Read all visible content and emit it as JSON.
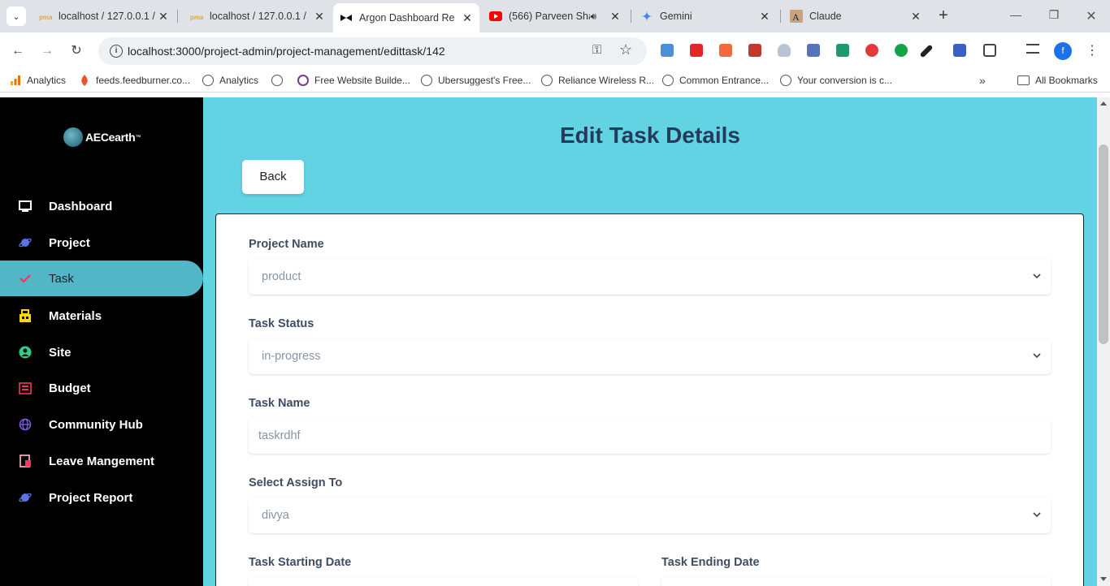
{
  "browser": {
    "tabs": [
      {
        "label": "localhost / 127.0.0.1 /",
        "icon": "phpmyadmin-icon"
      },
      {
        "label": "localhost / 127.0.0.1 /",
        "icon": "phpmyadmin-icon"
      },
      {
        "label": "Argon Dashboard Re",
        "icon": "argon-icon"
      },
      {
        "label": "(566) Parveen Sha",
        "icon": "youtube-icon"
      },
      {
        "label": "Gemini",
        "icon": "gemini-icon"
      },
      {
        "label": "Claude",
        "icon": "claude-icon"
      }
    ],
    "url": "localhost:3000/project-admin/project-management/edittask/142",
    "profile_initial": "f",
    "bookmarks": [
      {
        "label": "Analytics",
        "icon": "analytics-icon"
      },
      {
        "label": "feeds.feedburner.co...",
        "icon": "feedburner-icon"
      },
      {
        "label": "Analytics",
        "icon": "globe-icon"
      },
      {
        "label": "",
        "icon": "globe-icon"
      },
      {
        "label": "Free Website Builde...",
        "icon": "ring-icon"
      },
      {
        "label": "Ubersuggest's Free...",
        "icon": "globe-icon"
      },
      {
        "label": "Reliance Wireless R...",
        "icon": "globe-icon"
      },
      {
        "label": "Common Entrance...",
        "icon": "globe-icon"
      },
      {
        "label": "Your conversion is c...",
        "icon": "globe-icon"
      }
    ],
    "all_bookmarks": "All Bookmarks"
  },
  "sidebar": {
    "logo": {
      "text": "AECearth",
      "tm": "™"
    },
    "items": [
      {
        "label": "Dashboard",
        "icon": "monitor-icon"
      },
      {
        "label": "Project",
        "icon": "planet-icon"
      },
      {
        "label": "Task",
        "icon": "check-icon",
        "active": true
      },
      {
        "label": "Materials",
        "icon": "materials-icon"
      },
      {
        "label": "Site",
        "icon": "user-circle-icon"
      },
      {
        "label": "Budget",
        "icon": "budget-icon"
      },
      {
        "label": "Community Hub",
        "icon": "globe-icon"
      },
      {
        "label": "Leave Mangement",
        "icon": "leave-icon"
      },
      {
        "label": "Project Report",
        "icon": "planet-icon"
      }
    ]
  },
  "main": {
    "title": "Edit Task Details",
    "back_label": "Back",
    "form": {
      "project_name": {
        "label": "Project Name",
        "value": "product"
      },
      "task_status": {
        "label": "Task Status",
        "value": "in-progress"
      },
      "task_name": {
        "label": "Task Name",
        "value": "taskrdhf"
      },
      "assign_to": {
        "label": "Select Assign To",
        "value": "divya"
      },
      "start_date": {
        "label": "Task Starting Date"
      },
      "end_date": {
        "label": "Task Ending Date"
      }
    }
  },
  "colors": {
    "accent": "#62d3e3",
    "sidebar_active": "#51b7c7",
    "title": "#263a5a"
  }
}
